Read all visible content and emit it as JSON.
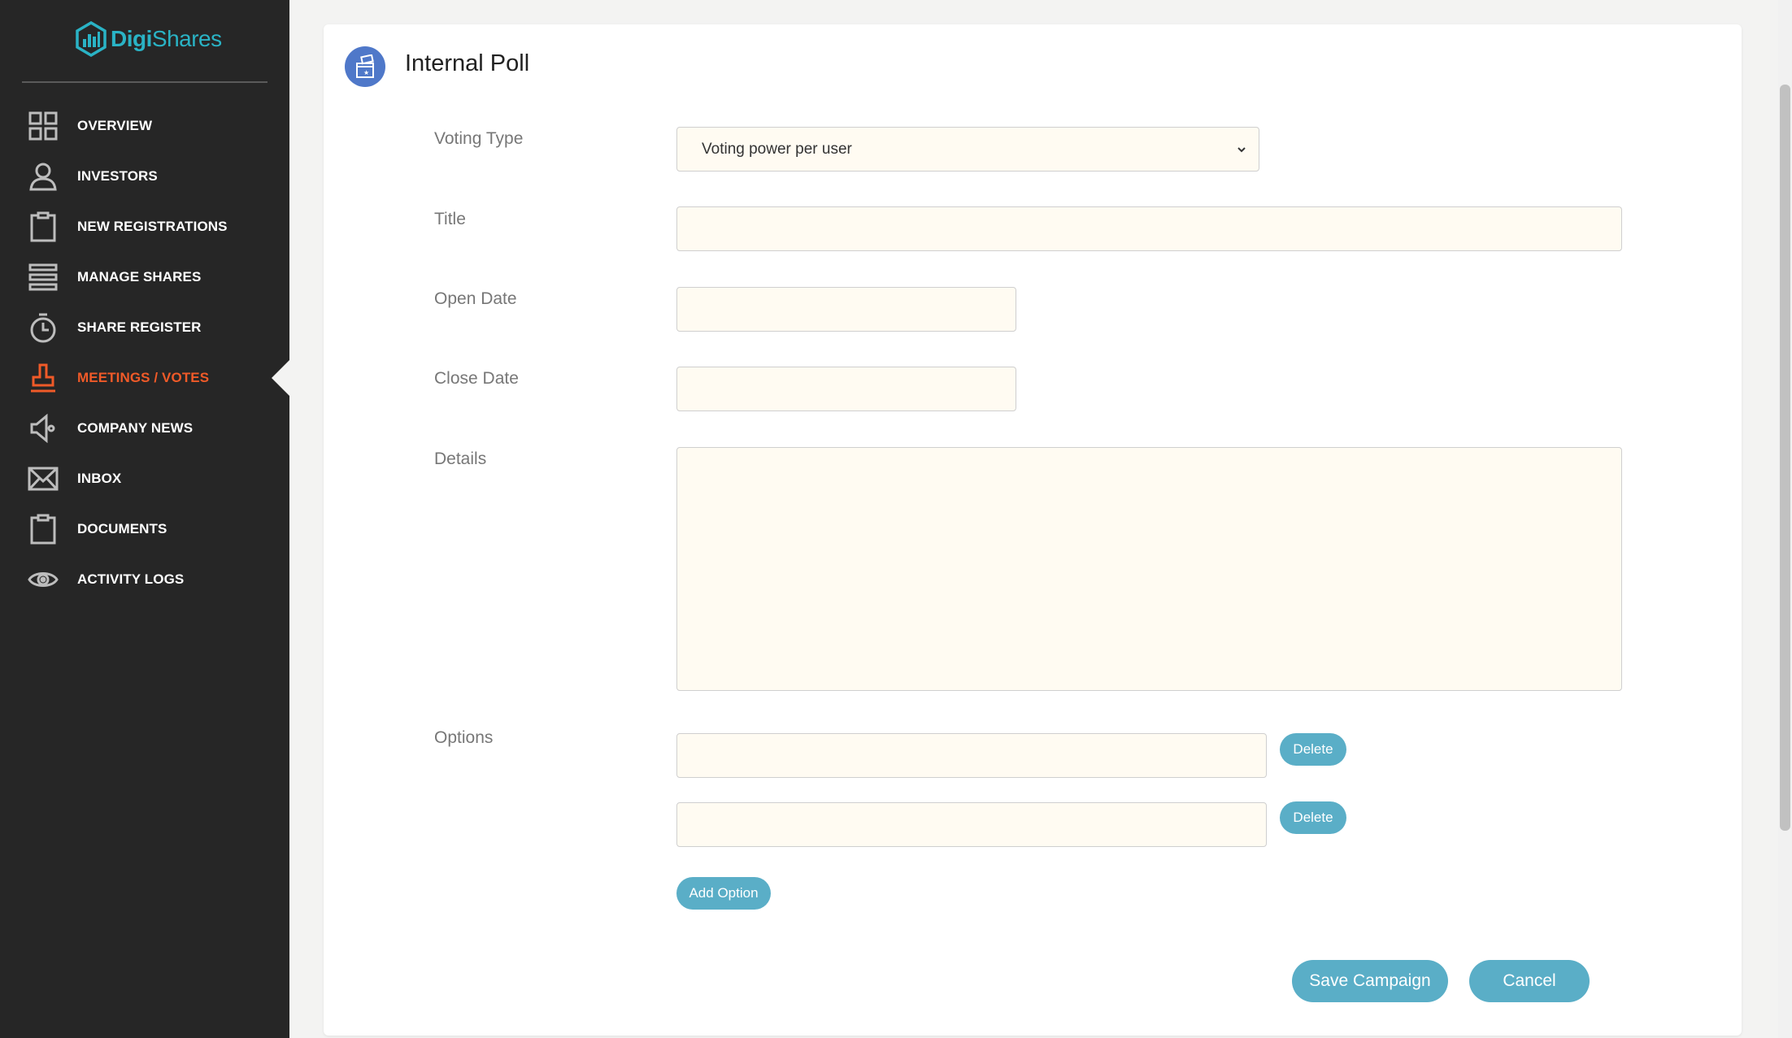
{
  "brand": {
    "part1": "Digi",
    "part2": "Shares",
    "accent": "#2ab3c5"
  },
  "sidebar": {
    "items": [
      {
        "label": "OVERVIEW",
        "icon": "grid-icon"
      },
      {
        "label": "INVESTORS",
        "icon": "person-icon"
      },
      {
        "label": "NEW REGISTRATIONS",
        "icon": "clipboard-icon"
      },
      {
        "label": "MANAGE SHARES",
        "icon": "list-icon"
      },
      {
        "label": "SHARE REGISTER",
        "icon": "stopwatch-icon"
      },
      {
        "label": "MEETINGS / VOTES",
        "icon": "stamp-icon",
        "active": true
      },
      {
        "label": "COMPANY NEWS",
        "icon": "megaphone-icon"
      },
      {
        "label": "INBOX",
        "icon": "envelope-icon"
      },
      {
        "label": "DOCUMENTS",
        "icon": "clipboard-icon"
      },
      {
        "label": "ACTIVITY LOGS",
        "icon": "eye-icon"
      }
    ],
    "active_color": "#f05a28"
  },
  "page": {
    "title": "Internal Poll",
    "icon": "ballot-box-icon"
  },
  "form": {
    "voting_type_label": "Voting Type",
    "voting_type_value": "Voting power per user",
    "title_label": "Title",
    "title_value": "",
    "open_date_label": "Open Date",
    "open_date_value": "",
    "close_date_label": "Close Date",
    "close_date_value": "",
    "details_label": "Details",
    "details_value": "",
    "options_label": "Options",
    "options": [
      {
        "value": "",
        "delete_label": "Delete"
      },
      {
        "value": "",
        "delete_label": "Delete"
      }
    ],
    "add_option_label": "Add Option",
    "save_label": "Save Campaign",
    "cancel_label": "Cancel"
  },
  "colors": {
    "button": "#5aaec7",
    "input_bg": "#fffbf2",
    "sidebar_bg": "#262626"
  }
}
